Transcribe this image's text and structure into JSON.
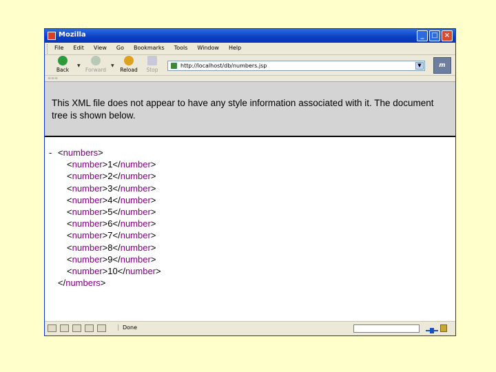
{
  "window": {
    "title": "Mozilla"
  },
  "menu": {
    "items": [
      "File",
      "Edit",
      "View",
      "Go",
      "Bookmarks",
      "Tools",
      "Window",
      "Help"
    ]
  },
  "toolbar": {
    "back": "Back",
    "forward": "Forward",
    "reload": "Reload",
    "stop": "Stop"
  },
  "address": {
    "url": "http://localhost/db/numbers.jsp"
  },
  "notice": {
    "text": "This XML file does not appear to have any style information associated with it. The document tree is shown below."
  },
  "xml": {
    "collapse": "-",
    "root_open": "<numbers>",
    "root_close": "</numbers>",
    "open_tag": "<number>",
    "close_tag": "</number>",
    "values": [
      "1",
      "2",
      "3",
      "4",
      "5",
      "6",
      "7",
      "8",
      "9",
      "10"
    ]
  },
  "status": {
    "text": "Done"
  },
  "colors": {
    "titlebar": "#0a3fc4",
    "tag": "#800080",
    "background": "#ffffcc"
  }
}
